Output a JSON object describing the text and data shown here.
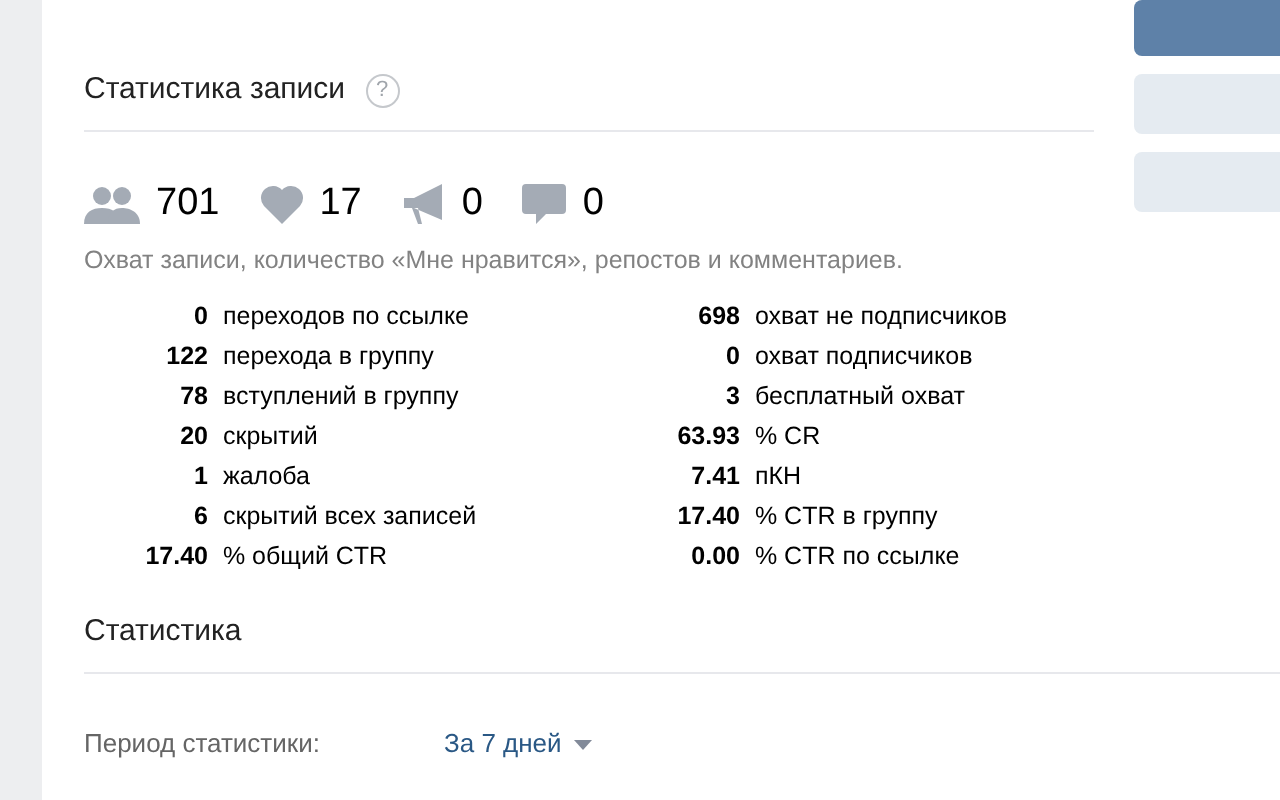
{
  "post_stats": {
    "title": "Статистика записи",
    "help": "?",
    "counters": [
      {
        "kind": "reach",
        "value": "701"
      },
      {
        "kind": "likes",
        "value": "17"
      },
      {
        "kind": "reposts",
        "value": "0"
      },
      {
        "kind": "comments",
        "value": "0"
      }
    ],
    "caption": "Охват записи, количество «Мне нравится», репостов и комментариев.",
    "left_metrics": [
      "**0** переходов по ссылке",
      "**122** перехода в группу",
      "**78** вступлений в группу",
      "**20** скрытий",
      "**1** жалоба",
      "**6** скрытий всех записей",
      "**17.40** % общий CTR"
    ],
    "right_metrics": [
      "**698** охват не подписчиков",
      "**0** охват подписчиков",
      "**3** бесплатный охват",
      "**63.93** % CR",
      "**7.41** пКН",
      "**17.40** % CTR в группу",
      "**0.00** % CTR по ссылке"
    ]
  },
  "side_buttons": [
    {
      "selected": true
    },
    {
      "selected": false
    },
    {
      "selected": false
    }
  ],
  "statistics": {
    "title": "Статистика",
    "period_label": "Период статистики:",
    "period_value": "За 7 дней"
  }
}
